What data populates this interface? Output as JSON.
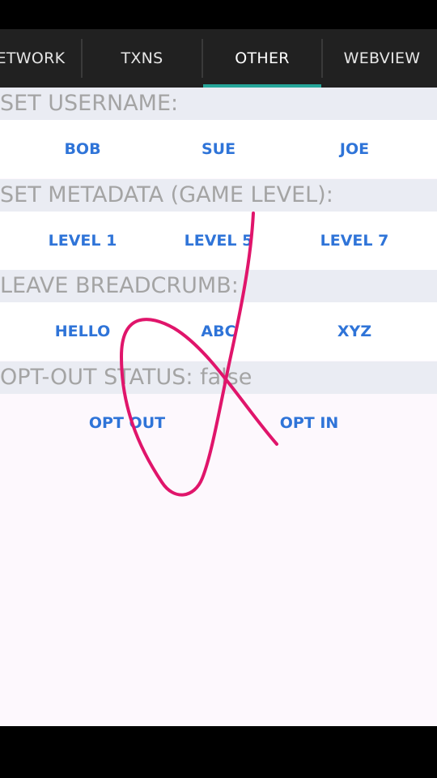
{
  "tabs": [
    {
      "label": "ETWORK"
    },
    {
      "label": "TXNS"
    },
    {
      "label": "OTHER",
      "active": true
    },
    {
      "label": "WEBVIEW"
    }
  ],
  "sections": {
    "username": {
      "header": "SET USERNAME:",
      "buttons": [
        "BOB",
        "SUE",
        "JOE"
      ]
    },
    "metadata": {
      "header": "SET METADATA (GAME LEVEL):",
      "buttons": [
        "LEVEL 1",
        "LEVEL 5",
        "LEVEL 7"
      ]
    },
    "breadcrumb": {
      "header": "LEAVE BREADCRUMB:",
      "buttons": [
        "HELLO",
        "ABC",
        "XYZ"
      ]
    },
    "optout": {
      "header": "OPT-OUT STATUS: false",
      "buttons": [
        "OPT OUT",
        "OPT IN"
      ]
    }
  },
  "colors": {
    "tab_bar": "#212121",
    "tab_indicator": "#26a69a",
    "section_header_bg": "#eaecf3",
    "section_header_text": "#a4a4a4",
    "button_text": "#2f74d8",
    "ink_stroke": "#e0156b"
  }
}
